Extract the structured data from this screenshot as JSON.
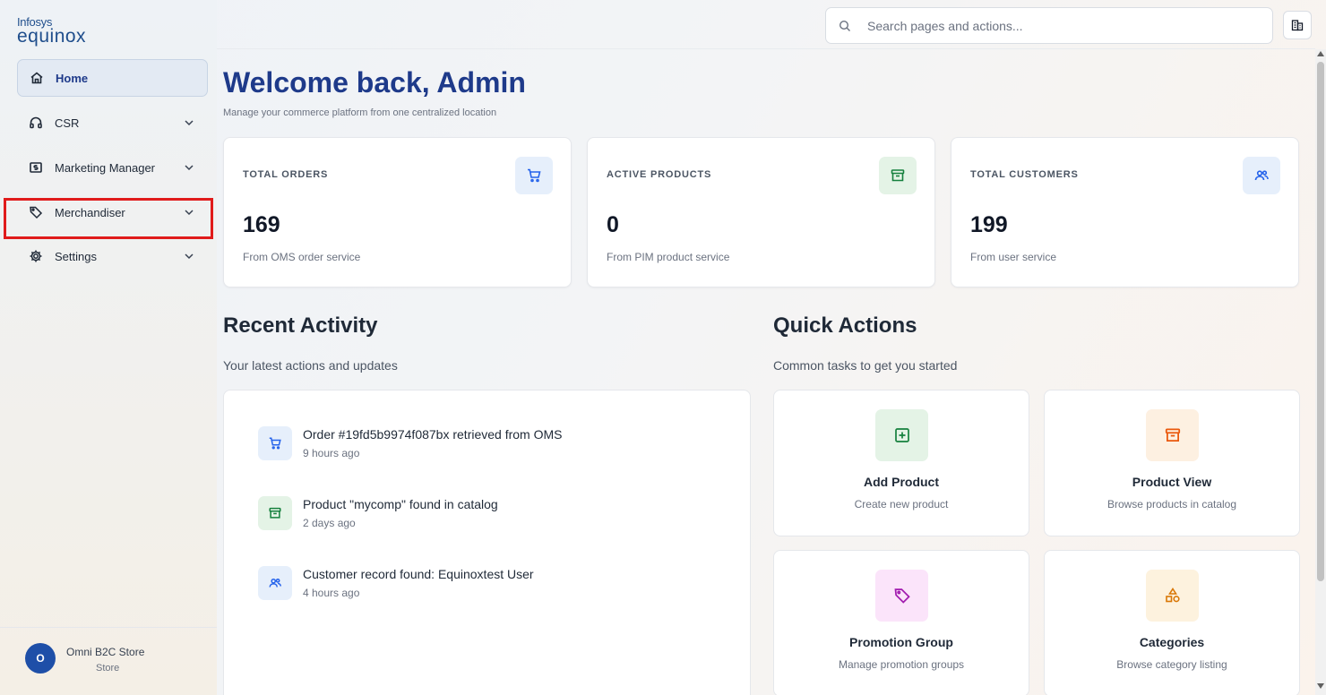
{
  "brand": {
    "line1": "Infosys",
    "line2": "equinox"
  },
  "sidebar": {
    "items": [
      {
        "label": "Home",
        "icon": "home-icon",
        "active": true
      },
      {
        "label": "CSR",
        "icon": "headset-icon"
      },
      {
        "label": "Marketing Manager",
        "icon": "dollar-icon"
      },
      {
        "label": "Merchandiser",
        "icon": "tag-icon"
      },
      {
        "label": "Settings",
        "icon": "gear-icon"
      }
    ],
    "store": {
      "initial": "O",
      "name": "Omni B2C Store",
      "type": "Store"
    }
  },
  "header": {
    "search_placeholder": "Search pages and actions..."
  },
  "welcome": {
    "title": "Welcome back, Admin",
    "subtitle": "Manage your commerce platform from one centralized location"
  },
  "stats": [
    {
      "label": "TOTAL ORDERS",
      "value": "169",
      "source": "From OMS order service",
      "icon": "cart-icon",
      "color": "#2563eb",
      "bg": "#e6effb"
    },
    {
      "label": "ACTIVE PRODUCTS",
      "value": "0",
      "source": "From PIM product service",
      "icon": "archive-icon",
      "color": "#15803d",
      "bg": "#e4f3e6"
    },
    {
      "label": "TOTAL CUSTOMERS",
      "value": "199",
      "source": "From user service",
      "icon": "users-icon",
      "color": "#2563eb",
      "bg": "#e6effb"
    }
  ],
  "recent_activity": {
    "title": "Recent Activity",
    "subtitle": "Your latest actions and updates",
    "items": [
      {
        "title": "Order #19fd5b9974f087bx retrieved from OMS",
        "time": "9 hours ago",
        "icon": "cart-icon"
      },
      {
        "title": "Product \"mycomp\" found in catalog",
        "time": "2 days ago",
        "icon": "archive-icon"
      },
      {
        "title": "Customer record found: Equinoxtest User",
        "time": "4 hours ago",
        "icon": "users-icon"
      }
    ]
  },
  "quick_actions": {
    "title": "Quick Actions",
    "subtitle": "Common tasks to get you started",
    "items": [
      {
        "title": "Add Product",
        "desc": "Create new product",
        "icon": "plus-square-icon"
      },
      {
        "title": "Product View",
        "desc": "Browse products in catalog",
        "icon": "archive-icon"
      },
      {
        "title": "Promotion Group",
        "desc": "Manage promotion groups",
        "icon": "tag-icon"
      },
      {
        "title": "Categories",
        "desc": "Browse category listing",
        "icon": "shapes-icon"
      }
    ]
  }
}
